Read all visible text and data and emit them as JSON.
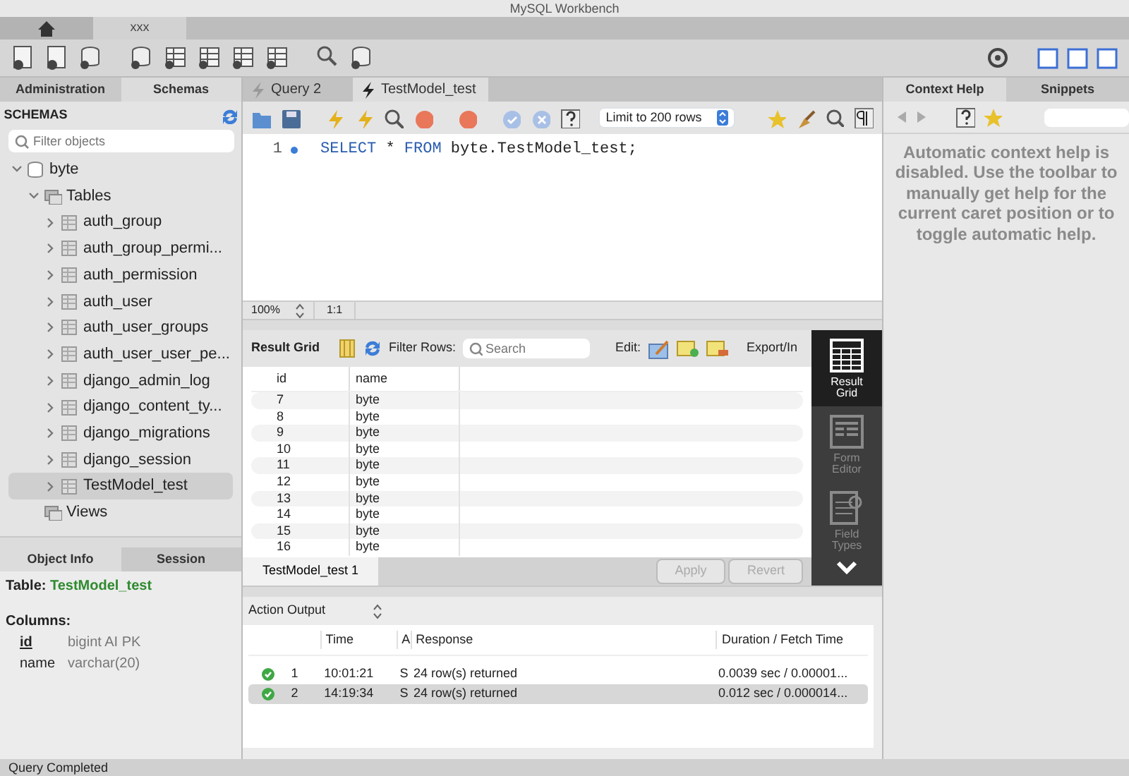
{
  "window": {
    "title": "MySQL Workbench"
  },
  "app_tabs": [
    {
      "kind": "home",
      "selected": false
    },
    {
      "kind": "connection",
      "label": "xxx",
      "selected": true
    }
  ],
  "sidebar": {
    "tabs": [
      {
        "label": "Administration",
        "selected": false
      },
      {
        "label": "Schemas",
        "selected": true
      }
    ],
    "header": "SCHEMAS",
    "filter": {
      "placeholder": "Filter objects"
    },
    "tree": [
      {
        "label": "byte",
        "kind": "schema",
        "expanded": true,
        "children": [
          {
            "label": "Tables",
            "kind": "folder",
            "expanded": true,
            "children": [
              {
                "label": "auth_group",
                "kind": "table",
                "expanded": false,
                "selected": false
              },
              {
                "label": "auth_group_permi...",
                "kind": "table",
                "expanded": false,
                "selected": false
              },
              {
                "label": "auth_permission",
                "kind": "table",
                "expanded": false,
                "selected": false
              },
              {
                "label": "auth_user",
                "kind": "table",
                "expanded": false,
                "selected": false
              },
              {
                "label": "auth_user_groups",
                "kind": "table",
                "expanded": false,
                "selected": false
              },
              {
                "label": "auth_user_user_pe...",
                "kind": "table",
                "expanded": false,
                "selected": false
              },
              {
                "label": "django_admin_log",
                "kind": "table",
                "expanded": false,
                "selected": false
              },
              {
                "label": "django_content_ty...",
                "kind": "table",
                "expanded": false,
                "selected": false
              },
              {
                "label": "django_migrations",
                "kind": "table",
                "expanded": false,
                "selected": false
              },
              {
                "label": "django_session",
                "kind": "table",
                "expanded": false,
                "selected": false
              },
              {
                "label": "TestModel_test",
                "kind": "table",
                "expanded": false,
                "selected": true
              }
            ]
          },
          {
            "label": "Views",
            "kind": "folder"
          }
        ]
      }
    ]
  },
  "object_info": {
    "tabs": [
      {
        "label": "Object Info",
        "selected": true
      },
      {
        "label": "Session",
        "selected": false
      }
    ],
    "table_label": "Table:",
    "table_name": "TestModel_test",
    "columns_label": "Columns:",
    "columns": [
      {
        "name": "id",
        "type": "bigint AI PK",
        "primary": true
      },
      {
        "name": "name",
        "type": "varchar(20)",
        "primary": false
      }
    ]
  },
  "query_tabs": [
    {
      "label": "Query 2",
      "selected": false
    },
    {
      "label": "TestModel_test",
      "selected": true
    }
  ],
  "editor": {
    "limit": "Limit to 200 rows",
    "lines": [
      {
        "number": "1",
        "tokens": [
          {
            "text": "SELECT",
            "kind": "keyword"
          },
          {
            "text": " * ",
            "kind": "plain"
          },
          {
            "text": "FROM",
            "kind": "keyword"
          },
          {
            "text": " byte.TestModel_test;",
            "kind": "plain"
          }
        ]
      }
    ],
    "zoom": "100%",
    "position": "1:1"
  },
  "results": {
    "title": "Result Grid",
    "filter_label": "Filter Rows:",
    "search": {
      "placeholder": "Search"
    },
    "edit_label": "Edit:",
    "export_label": "Export/In",
    "columns": [
      "id",
      "name"
    ],
    "rows": [
      [
        "7",
        "byte"
      ],
      [
        "8",
        "byte"
      ],
      [
        "9",
        "byte"
      ],
      [
        "10",
        "byte"
      ],
      [
        "11",
        "byte"
      ],
      [
        "12",
        "byte"
      ],
      [
        "13",
        "byte"
      ],
      [
        "14",
        "byte"
      ],
      [
        "15",
        "byte"
      ],
      [
        "16",
        "byte"
      ]
    ],
    "views": [
      {
        "label": "Result Grid",
        "kind": "grid",
        "selected": true
      },
      {
        "label": "Form Editor",
        "kind": "form",
        "selected": false
      },
      {
        "label": "Field Types",
        "kind": "fields",
        "selected": false
      }
    ],
    "result_tabs": [
      {
        "label": "TestModel_test 1",
        "selected": true
      }
    ],
    "buttons": [
      {
        "label": "Apply",
        "disabled": true
      },
      {
        "label": "Revert",
        "disabled": true
      }
    ]
  },
  "output": {
    "selector": "Action Output",
    "columns": [
      "Time",
      "A",
      "Response",
      "Duration / Fetch Time"
    ],
    "rows": [
      {
        "succeeded": true,
        "number": "1",
        "time": "10:01:21",
        "action": "S",
        "response": "24 row(s) returned",
        "duration": "0.0039 sec / 0.00001...",
        "selected": false
      },
      {
        "succeeded": true,
        "number": "2",
        "time": "14:19:34",
        "action": "S",
        "response": "24 row(s) returned",
        "duration": "0.012 sec / 0.000014...",
        "selected": true
      }
    ]
  },
  "context_help": {
    "tabs": [
      {
        "label": "Context Help",
        "selected": true
      },
      {
        "label": "Snippets",
        "selected": false
      }
    ],
    "message": "Automatic context help is disabled. Use the toolbar to manually get help for the current caret position or to toggle automatic help."
  },
  "status_bar": "Query Completed"
}
